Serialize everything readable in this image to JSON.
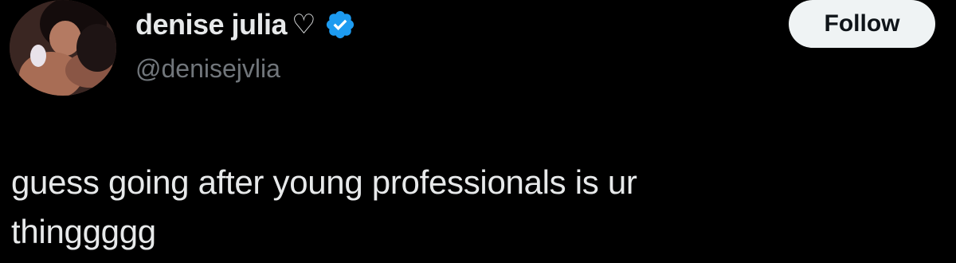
{
  "author": {
    "display_name": "denise julia",
    "name_emoji": "♡",
    "handle": "@denisejvlia",
    "verified": true,
    "verified_color": "#1d9bf0"
  },
  "actions": {
    "follow_label": "Follow"
  },
  "tweet": {
    "text": "guess going after young professionals is ur\nthinggggg"
  },
  "icons": {
    "avatar": "profile-photo",
    "verified": "verified-badge-icon",
    "name_emoji": "white-heart-icon"
  },
  "colors": {
    "background": "#000000",
    "primary_text": "#e7e9ea",
    "secondary_text": "#71767b",
    "follow_bg": "#eff3f4",
    "follow_text": "#0f1419"
  }
}
